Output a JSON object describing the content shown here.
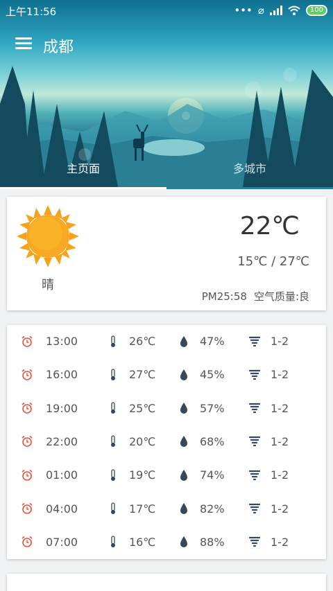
{
  "status_bar": {
    "time": "上午11:56",
    "battery": "100"
  },
  "app_bar": {
    "city": "成都"
  },
  "tabs": [
    {
      "label": "主页面"
    },
    {
      "label": "多城市"
    }
  ],
  "now": {
    "condition": "晴",
    "temperature": "22℃",
    "range": "15℃ / 27℃",
    "pm25": "PM25:58",
    "air_quality": "空气质量:良"
  },
  "hourly": [
    {
      "time": "13:00",
      "temp": "26℃",
      "humidity": "47%",
      "wind": "1-2"
    },
    {
      "time": "16:00",
      "temp": "27℃",
      "humidity": "45%",
      "wind": "1-2"
    },
    {
      "time": "19:00",
      "temp": "25℃",
      "humidity": "57%",
      "wind": "1-2"
    },
    {
      "time": "22:00",
      "temp": "20℃",
      "humidity": "68%",
      "wind": "1-2"
    },
    {
      "time": "01:00",
      "temp": "19℃",
      "humidity": "74%",
      "wind": "1-2"
    },
    {
      "time": "04:00",
      "temp": "17℃",
      "humidity": "82%",
      "wind": "1-2"
    },
    {
      "time": "07:00",
      "temp": "16℃",
      "humidity": "88%",
      "wind": "1-2"
    }
  ],
  "icons": {
    "time": "alarm-clock-icon",
    "temp": "thermometer-icon",
    "humidity": "water-drop-icon",
    "wind": "tornado-icon"
  },
  "colors": {
    "alarm": "#e8503a",
    "icon_dark": "#34495e",
    "sun": "#f7a21b"
  }
}
